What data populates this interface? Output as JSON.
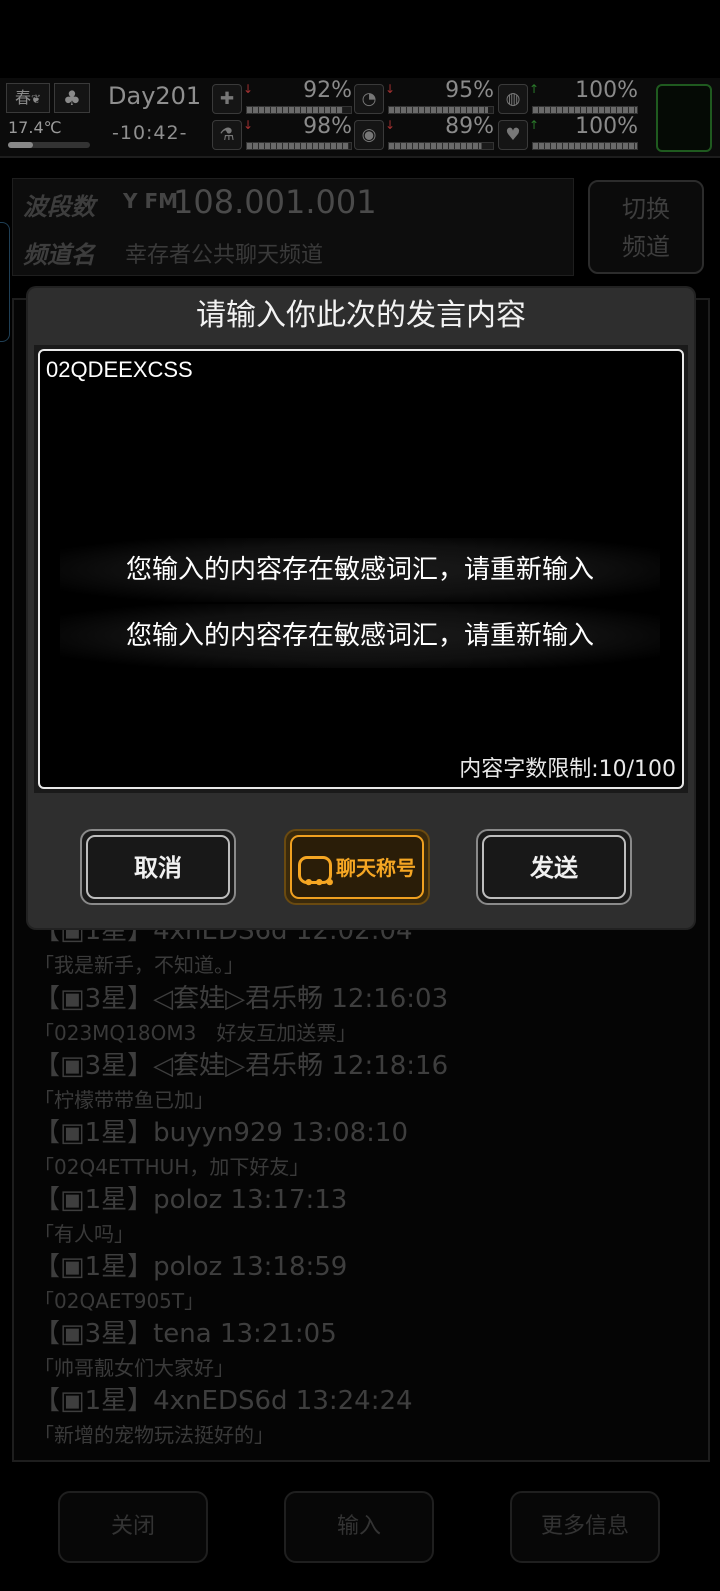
{
  "status": {
    "season": "春",
    "tree_icon": "tree-icon",
    "temperature": "17.4℃",
    "temperature_level": 0.3,
    "day": "Day201",
    "time": "-10:42-",
    "gauges": [
      {
        "icon": "medkit-icon",
        "glyph": "✚",
        "arrow": "↓",
        "arrow_color": "#a03030",
        "value": "92%",
        "level": 0.92
      },
      {
        "icon": "stomach-icon",
        "glyph": "◔",
        "arrow": "↓",
        "arrow_color": "#a03030",
        "value": "95%",
        "level": 0.95
      },
      {
        "icon": "lungs-icon",
        "glyph": "◍",
        "arrow": "↑",
        "arrow_color": "#2a7a2a",
        "value": "100%",
        "level": 1.0
      },
      {
        "icon": "flask-icon",
        "glyph": "⚗",
        "arrow": "↓",
        "arrow_color": "#a03030",
        "value": "98%",
        "level": 0.98
      },
      {
        "icon": "water-drop-icon",
        "glyph": "◉",
        "arrow": "↓",
        "arrow_color": "#a03030",
        "value": "89%",
        "level": 0.89
      },
      {
        "icon": "heart-icon",
        "glyph": "♥",
        "arrow": "↑",
        "arrow_color": "#2a7a2a",
        "value": "100%",
        "level": 1.0
      }
    ]
  },
  "channel": {
    "band_label": "波段数",
    "fm_label": "Y FM",
    "frequency": "108.001.001",
    "name_label": "频道名",
    "name": "幸存者公共聊天频道",
    "switch_line1": "切换",
    "switch_line2": "频道"
  },
  "chat": [
    {
      "head": "【▣1星】4xnEDS6d 12:02:04",
      "body": "「我是新手，不知道。」"
    },
    {
      "head": "【▣3星】◁套娃▷君乐畅 12:16:03",
      "body": "「023MQ18OM3　好友互加送票」"
    },
    {
      "head": "【▣3星】◁套娃▷君乐畅 12:18:16",
      "body": "「柠檬带带鱼已加」"
    },
    {
      "head": "【▣1星】buyyn929 13:08:10",
      "body": "「02Q4ETTHUH，加下好友」"
    },
    {
      "head": "【▣1星】poloz 13:17:13",
      "body": "「有人吗」"
    },
    {
      "head": "【▣1星】poloz 13:18:59",
      "body": "「02QAET905T」"
    },
    {
      "head": "【▣3星】tena 13:21:05",
      "body": "「帅哥靓女们大家好」"
    },
    {
      "head": "【▣1星】4xnEDS6d 13:24:24",
      "body": "「新增的宠物玩法挺好的」"
    }
  ],
  "bottom_bar": {
    "close": "关闭",
    "input": "输入",
    "more": "更多信息"
  },
  "dialog": {
    "title": "请输入你此次的发言内容",
    "input_value": "02QDEEXCSS",
    "char_limit": "内容字数限制:10/100",
    "cancel": "取消",
    "nickname": "聊天称号",
    "send": "发送"
  },
  "toasts": [
    "您输入的内容存在敏感词汇，请重新输入",
    "您输入的内容存在敏感词汇，请重新输入"
  ]
}
